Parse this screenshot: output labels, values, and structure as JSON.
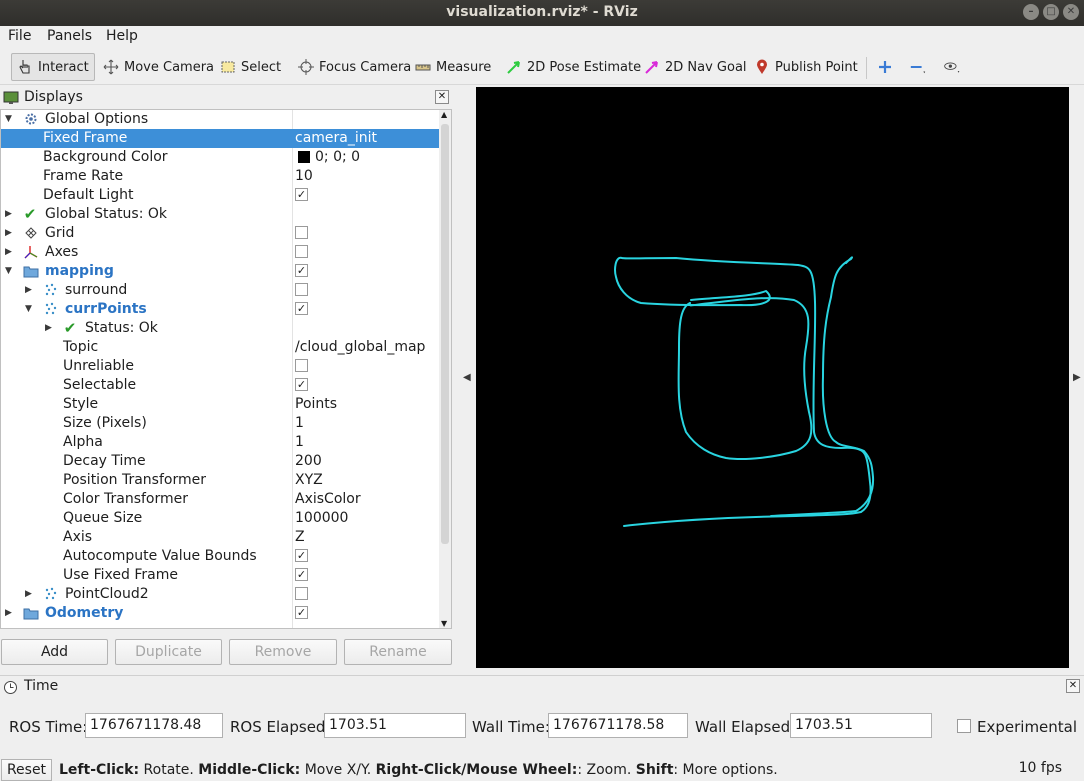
{
  "window": {
    "title": "visualization.rviz* - RViz"
  },
  "menubar": {
    "items": [
      {
        "label": "File"
      },
      {
        "label": "Panels"
      },
      {
        "label": "Help"
      }
    ]
  },
  "toolbar": {
    "tools": [
      {
        "label": "Interact",
        "icon": "hand-pointer-icon",
        "active": true
      },
      {
        "label": "Move Camera",
        "icon": "move-arrows-icon"
      },
      {
        "label": "Select",
        "icon": "selection-rect-icon"
      },
      {
        "label": "Focus Camera",
        "icon": "crosshair-icon"
      },
      {
        "label": "Measure",
        "icon": "ruler-icon"
      },
      {
        "label": "2D Pose Estimate",
        "icon": "green-arrow-icon",
        "color": "#2ecc40"
      },
      {
        "label": "2D Nav Goal",
        "icon": "magenta-arrow-icon",
        "color": "#d92ad9"
      },
      {
        "label": "Publish Point",
        "icon": "map-pin-icon",
        "color": "#c0392b"
      }
    ]
  },
  "displays": {
    "title": "Displays",
    "rows": [
      {
        "name": "Global Options",
        "value": ""
      },
      {
        "name": "Fixed Frame",
        "value": "camera_init"
      },
      {
        "name": "Background Color",
        "value": "0; 0; 0"
      },
      {
        "name": "Frame Rate",
        "value": "10"
      },
      {
        "name": "Default Light",
        "value": ""
      },
      {
        "name": "Global Status: Ok",
        "value": ""
      },
      {
        "name": "Grid",
        "value": ""
      },
      {
        "name": "Axes",
        "value": ""
      },
      {
        "name": "mapping",
        "value": ""
      },
      {
        "name": "surround",
        "value": ""
      },
      {
        "name": "currPoints",
        "value": ""
      },
      {
        "name": "Status: Ok",
        "value": ""
      },
      {
        "name": "Topic",
        "value": "/cloud_global_map"
      },
      {
        "name": "Unreliable",
        "value": ""
      },
      {
        "name": "Selectable",
        "value": ""
      },
      {
        "name": "Style",
        "value": "Points"
      },
      {
        "name": "Size (Pixels)",
        "value": "1"
      },
      {
        "name": "Alpha",
        "value": "1"
      },
      {
        "name": "Decay Time",
        "value": "200"
      },
      {
        "name": "Position Transformer",
        "value": "XYZ"
      },
      {
        "name": "Color Transformer",
        "value": "AxisColor"
      },
      {
        "name": "Queue Size",
        "value": "100000"
      },
      {
        "name": "Axis",
        "value": "Z"
      },
      {
        "name": "Autocompute Value Bounds",
        "value": ""
      },
      {
        "name": "Use Fixed Frame",
        "value": ""
      },
      {
        "name": "PointCloud2",
        "value": ""
      },
      {
        "name": "Odometry",
        "value": ""
      }
    ],
    "checks": {
      "default_light": true,
      "grid": false,
      "axes": false,
      "mapping": true,
      "surround": false,
      "currpoints": true,
      "unreliable": false,
      "selectable": true,
      "autocompute": true,
      "use_fixed_frame": true,
      "pointcloud2": false,
      "odometry": true
    },
    "buttons": {
      "add": "Add",
      "duplicate": "Duplicate",
      "remove": "Remove",
      "rename": "Rename"
    }
  },
  "viewport": {
    "background": "#000000",
    "trajectory_color": "#29d4e0"
  },
  "time": {
    "title": "Time",
    "ros_time_label": "ROS Time:",
    "ros_time": "1767671178.48",
    "ros_elapsed_label": "ROS Elapsed:",
    "ros_elapsed": "1703.51",
    "wall_time_label": "Wall Time:",
    "wall_time": "1767671178.58",
    "wall_elapsed_label": "Wall Elapsed:",
    "wall_elapsed": "1703.51",
    "experimental_label": "Experimental",
    "experimental": false
  },
  "status": {
    "reset": "Reset",
    "hint_parts": [
      {
        "text": "Left-Click:",
        "bold": true
      },
      {
        "text": " Rotate. ",
        "bold": false
      },
      {
        "text": "Middle-Click:",
        "bold": true
      },
      {
        "text": " Move X/Y. ",
        "bold": false
      },
      {
        "text": "Right-Click/Mouse Wheel:",
        "bold": true
      },
      {
        "text": ": Zoom. ",
        "bold": false
      },
      {
        "text": "Shift",
        "bold": true
      },
      {
        "text": ": More options.",
        "bold": false
      }
    ],
    "fps": "10 fps"
  }
}
